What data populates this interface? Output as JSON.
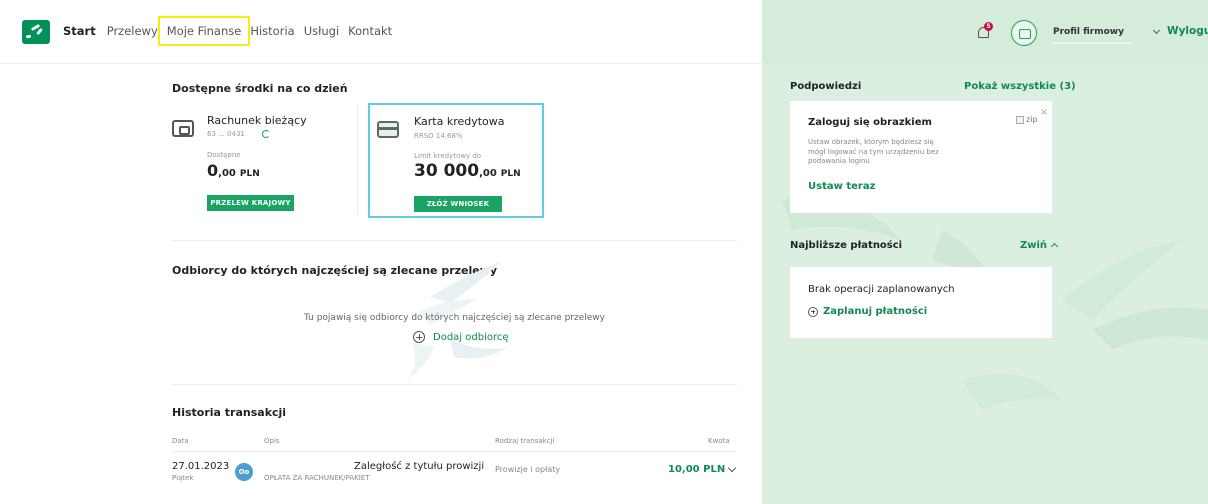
{
  "nav": {
    "items": [
      {
        "label": "Start"
      },
      {
        "label": "Przelewy"
      },
      {
        "label": "Moje Finanse"
      },
      {
        "label": "Historia"
      },
      {
        "label": "Usługi"
      },
      {
        "label": "Kontakt"
      }
    ],
    "active_index": 0,
    "highlighted_index": 2
  },
  "funds": {
    "title": "Dostępne środki na co dzień",
    "current_account": {
      "title": "Rachunek bieżący",
      "number": "63 ... 0431",
      "available_label": "Dostępne",
      "amount_int": "0",
      "amount_dec": ",00",
      "currency": "PLN",
      "button": "PRZELEW KRAJOWY"
    },
    "credit_card": {
      "title": "Karta kredytowa",
      "rrso": "RRSO 14,68%",
      "limit_label": "Limit kredytowy do",
      "amount_int": "30 000",
      "amount_dec": ",00",
      "currency": "PLN",
      "button": "ZŁÓŻ WNIOSEK"
    }
  },
  "recipients": {
    "title": "Odbiorcy do których najczęściej są zlecane przelewy",
    "empty_text": "Tu pojawią się odbiorcy do których najczęściej są zlecane przelewy",
    "add_label": "Dodaj odbiorcę"
  },
  "history": {
    "title": "Historia transakcji",
    "columns": [
      "Data",
      "Opis",
      "Rodzaj transakcji",
      "Kwota"
    ],
    "rows": [
      {
        "date": "27.01.2023",
        "day": "Piątek",
        "icon_text": "Oo",
        "description": "Zaległość z tytułu prowizji",
        "description_sub": "OPŁATA ZA RACHUNEK/PAKIET",
        "type": "Prowizje i opłaty",
        "amount": "10,00 PLN"
      }
    ]
  },
  "header_right": {
    "notification_count": "5",
    "profile_label": "Profil firmowy",
    "logout_label": "Wyloguj"
  },
  "hints": {
    "title": "Podpowiedzi",
    "show_all": "Pokaż wszystkie (3)",
    "card": {
      "title": "Zaloguj się obrazkiem",
      "body": [
        "Ustaw obrazek, którym będziesz się",
        "mógł logować na tym urządzeniu bez",
        "podawania loginu"
      ],
      "action": "Ustaw teraz",
      "image_alt": "zip",
      "close": "×"
    }
  },
  "payments": {
    "title": "Najbliższe płatności",
    "collapse_label": "Zwiń",
    "empty_text": "Brak operacji zaplanowanych",
    "plan_label": "Zaplanuj płatności"
  },
  "colors": {
    "brand_green": "#00915a",
    "accent_green": "#1aa464",
    "link_green": "#0f8a52",
    "sidebar_bg": "#dbefe0",
    "highlight_yellow": "#f5ec14",
    "credit_border": "#5ccfe0"
  }
}
